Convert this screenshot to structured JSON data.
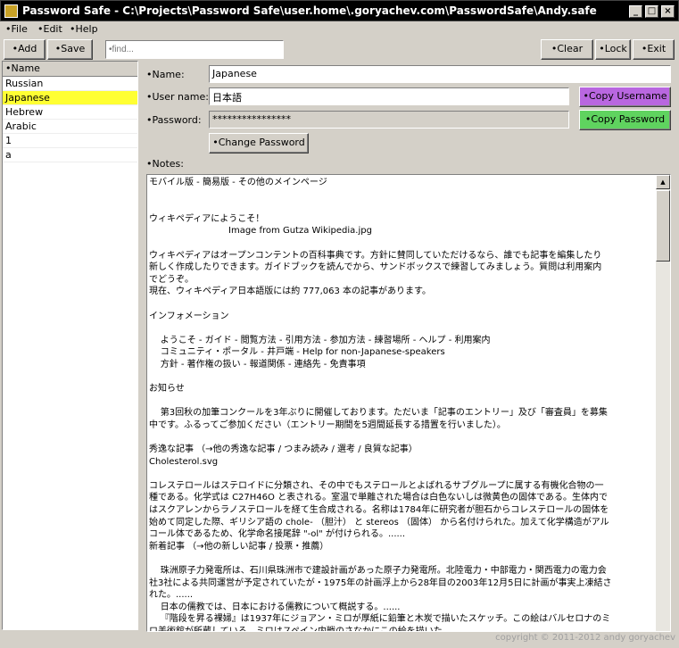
{
  "window": {
    "title": "Password Safe - C:\\Projects\\Password Safe\\user.home\\.goryachev.com\\PasswordSafe\\Andy.safe"
  },
  "menu": {
    "file": "•File",
    "edit": "•Edit",
    "help": "•Help"
  },
  "toolbar": {
    "add": "•Add",
    "save": "•Save",
    "find_placeholder": "•find...",
    "clear": "•Clear",
    "lock": "•Lock",
    "exit": "•Exit"
  },
  "list": {
    "header": "•Name",
    "items": [
      "Russian",
      "Japanese",
      "Hebrew",
      "Arabic",
      "1",
      "a"
    ],
    "selected_index": 1
  },
  "form": {
    "name_label": "•Name:",
    "name_value": "Japanese",
    "username_label": "•User name:",
    "username_value": "日本語",
    "password_label": "•Password:",
    "password_value": "****************",
    "copy_username": "•Copy Username",
    "copy_password": "•Copy Password",
    "change_password": "•Change Password",
    "notes_label": "•Notes:"
  },
  "notes": "モバイル版 - 簡易版 - その他のメインページ\n\n\nウィキペディアにようこそ！\n                            Image from Gutza Wikipedia.jpg\n\nウィキペディアはオープンコンテントの百科事典です。方針に賛同していただけるなら、誰でも記事を編集したり\n新しく作成したりできます。ガイドブックを読んでから、サンドボックスで練習してみましょう。質問は利用案内\nでどうぞ。\n現在、ウィキペディア日本語版には約 777,063 本の記事があります。\n\nインフォメーション\n\n    ようこそ - ガイド - 閲覧方法 - 引用方法 - 参加方法 - 練習場所 - ヘルプ - 利用案内\n    コミュニティ・ポータル - 井戸端 - Help for non-Japanese-speakers\n    方針 - 著作権の扱い - 報道関係 - 連絡先 - 免責事項\n\nお知らせ\n\n    第3回秋の加筆コンクールを3年ぶりに開催しております。ただいま「記事のエントリー」及び「審査員」を募集\n中です。ふるってご参加ください（エントリー期間を5週間延長する措置を行いました）。\n\n秀逸な記事 （→他の秀逸な記事 / つまみ読み / 選考 / 良質な記事）\nCholesterol.svg\n\nコレステロールはステロイドに分類され、その中でもステロールとよばれるサブグループに属する有機化合物の一\n種である。化学式は C27H46O と表される。室温で単離された場合は白色ないしは微黄色の固体である。生体内で\nはスクアレンからラノステロールを経て生合成される。名称は1784年に研究者が胆石からコレステロールの固体を\n始めて同定した際、ギリシア語の chole- （胆汁） と stereos （固体） から名付けられた。加えて化学構造がアル\nコール体であるため、化学命名接尾辞 \"-ol\" が付けられる。......\n新着記事 （→他の新しい記事 / 投票・推薦）\n\n    珠洲原子力発電所は、石川県珠洲市で建設計画があった原子力発電所。北陸電力・中部電力・関西電力の電力会\n社3社による共同運営が予定されていたが・1975年の計画浮上から28年目の2003年12月5日に計画が事実上凍結さ\nれた。......\n    日本の儒教では、日本における儒教について概説する。......\n    『階段を昇る裸婦』は1937年にジョアン・ミロが厚紙に鉛筆と木炭で描いたスケッチ。この絵はバルセロナのミ\nロ美術館が所蔵している。ミロはスペイン内戦のさなかにこの絵を描いた。......\n    ヴァンダル戦争は、北アフリカ（現在のチュニジアとアルジェリア東部）において東ローマ帝国とヴァンダル王",
  "footer": {
    "copyright": "copyright © 2011-2012 andy goryachev"
  },
  "colors": {
    "selection": "#ffff33",
    "copy_username_bg": "#b967e0",
    "copy_password_bg": "#5fd35f"
  }
}
